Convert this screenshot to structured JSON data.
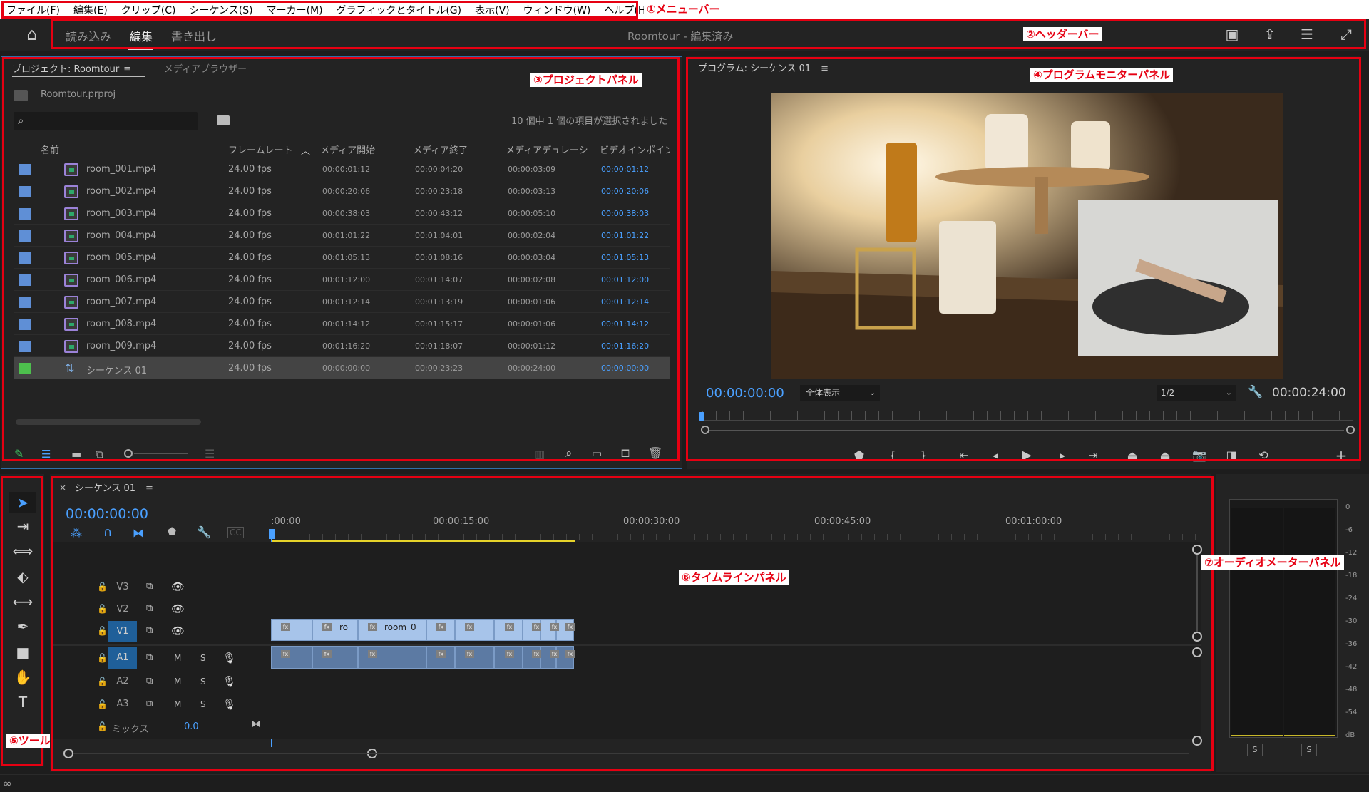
{
  "menu": [
    "ファイル(F)",
    "編集(E)",
    "クリップ(C)",
    "シーケンス(S)",
    "マーカー(M)",
    "グラフィックとタイトル(G)",
    "表示(V)",
    "ウィンドウ(W)",
    "ヘルプ(H)"
  ],
  "header": {
    "tabs": [
      "読み込み",
      "編集",
      "書き出し"
    ],
    "project_name": "Roomtour",
    "separator": " - ",
    "status": "編集済み"
  },
  "annotations": {
    "menubar": "①メニューバー",
    "headerbar": "②ヘッダーバー",
    "project": "③プロジェクトパネル",
    "program": "④プログラムモニターパネル",
    "tools": "⑤ツールパネル",
    "timeline": "⑥タイムラインパネル",
    "audio": "⑦オーディオメーターパネル"
  },
  "project": {
    "tab_active": "プロジェクト: Roomtour",
    "tab_inactive": "メディアブラウザー",
    "file": "Roomtour.prproj",
    "selection_status": "10 個中 1 個の項目が選択されました",
    "columns": [
      "名前",
      "フレームレート",
      "メディア開始",
      "メディア終了",
      "メディアデュレーシ",
      "ビデオインポイン"
    ],
    "rows": [
      {
        "name": "room_001.mp4",
        "fps": "24.00 fps",
        "start": "00:00:01:12",
        "end": "00:00:04:20",
        "dur": "00:00:03:09",
        "in": "00:00:01:12"
      },
      {
        "name": "room_002.mp4",
        "fps": "24.00 fps",
        "start": "00:00:20:06",
        "end": "00:00:23:18",
        "dur": "00:00:03:13",
        "in": "00:00:20:06"
      },
      {
        "name": "room_003.mp4",
        "fps": "24.00 fps",
        "start": "00:00:38:03",
        "end": "00:00:43:12",
        "dur": "00:00:05:10",
        "in": "00:00:38:03"
      },
      {
        "name": "room_004.mp4",
        "fps": "24.00 fps",
        "start": "00:01:01:22",
        "end": "00:01:04:01",
        "dur": "00:00:02:04",
        "in": "00:01:01:22"
      },
      {
        "name": "room_005.mp4",
        "fps": "24.00 fps",
        "start": "00:01:05:13",
        "end": "00:01:08:16",
        "dur": "00:00:03:04",
        "in": "00:01:05:13"
      },
      {
        "name": "room_006.mp4",
        "fps": "24.00 fps",
        "start": "00:01:12:00",
        "end": "00:01:14:07",
        "dur": "00:00:02:08",
        "in": "00:01:12:00"
      },
      {
        "name": "room_007.mp4",
        "fps": "24.00 fps",
        "start": "00:01:12:14",
        "end": "00:01:13:19",
        "dur": "00:00:01:06",
        "in": "00:01:12:14"
      },
      {
        "name": "room_008.mp4",
        "fps": "24.00 fps",
        "start": "00:01:14:12",
        "end": "00:01:15:17",
        "dur": "00:00:01:06",
        "in": "00:01:14:12"
      },
      {
        "name": "room_009.mp4",
        "fps": "24.00 fps",
        "start": "00:01:16:20",
        "end": "00:01:18:07",
        "dur": "00:00:01:12",
        "in": "00:01:16:20"
      },
      {
        "name": "シーケンス 01",
        "fps": "24.00 fps",
        "start": "00:00:00:00",
        "end": "00:00:23:23",
        "dur": "00:00:24:00",
        "in": "00:00:00:00"
      }
    ]
  },
  "program": {
    "title": "プログラム: シーケンス 01",
    "timecode": "00:00:00:00",
    "zoom": "全体表示",
    "resolution": "1/2",
    "duration": "00:00:24:00"
  },
  "timeline": {
    "title": "シーケンス 01",
    "timecode": "00:00:00:00",
    "ruler": [
      ":00:00",
      "00:00:15:00",
      "00:00:30:00",
      "00:00:45:00",
      "00:01:00:00"
    ],
    "video_tracks": [
      "V3",
      "V2",
      "V1"
    ],
    "audio_tracks": [
      "A1",
      "A2",
      "A3"
    ],
    "mix_label": "ミックス",
    "mix_value": "0.0",
    "mute": "M",
    "solo": "S",
    "clip_labels": [
      "ro",
      "room_0"
    ]
  },
  "audio_meter": {
    "scale": [
      "0",
      "-6",
      "-12",
      "-18",
      "-24",
      "-30",
      "-36",
      "-42",
      "-48",
      "-54",
      "dB"
    ],
    "solo_buttons": [
      "S",
      "S"
    ]
  },
  "colors": {
    "accent_red": "#e60012",
    "timecode_blue": "#4aa0ff",
    "clip_blue": "#a7c4ea",
    "track_active": "#1f5f99"
  }
}
